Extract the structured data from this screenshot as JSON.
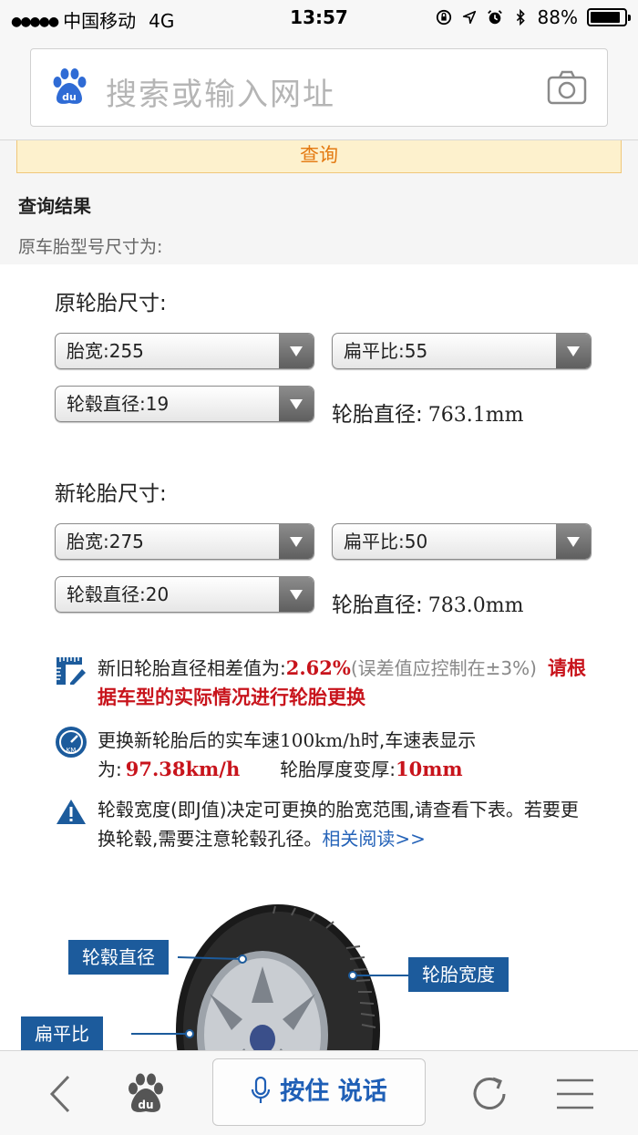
{
  "status_bar": {
    "signal": "●●●●●",
    "carrier": "中国移动",
    "network": "4G",
    "time": "13:57",
    "battery": "88%",
    "battery_level": 0.88
  },
  "search": {
    "placeholder": "搜索或输入网址",
    "logo_text": "du"
  },
  "query_button": "查询",
  "result": {
    "title": "查询结果",
    "subtitle": "原车胎型号尺寸为:"
  },
  "original": {
    "label": "原轮胎尺寸:",
    "width": "胎宽:255",
    "aspect": "扁平比:55",
    "rim": "轮毂直径:19",
    "diameter_label": "轮胎直径:",
    "diameter_value": "763.1mm"
  },
  "new": {
    "label": "新轮胎尺寸:",
    "width": "胎宽:275",
    "aspect": "扁平比:50",
    "rim": "轮毂直径:20",
    "diameter_label": "轮胎直径:",
    "diameter_value": "783.0mm"
  },
  "info": {
    "diff_prefix": "新旧轮胎直径相差值为:",
    "diff_value": "2.62%",
    "diff_note": "(误差值应控制在±3%)",
    "diff_advice": "请根据车型的实际情况进行轮胎更换",
    "speed_prefix": "更换新轮胎后的实车速",
    "speed_base": "100km/h",
    "speed_mid": "时,车速表显示为:",
    "speed_value": "97.38km/h",
    "thickness_label": "轮胎厚度变厚:",
    "thickness_value": "10mm",
    "rim_note": "轮毂宽度(即J值)决定可更换的胎宽范围,请查看下表。若要更换轮毂,需要注意轮毂孔径。",
    "rim_link": "相关阅读>>"
  },
  "diagram": {
    "rim_diameter": "轮毂直径",
    "tire_width": "轮胎宽度",
    "aspect_ratio": "扁平比"
  },
  "toolbar": {
    "voice": "按住 说话",
    "logo_text": "du"
  },
  "colors": {
    "accent_blue": "#1c5b9c",
    "warning_red": "#c8141c",
    "query_orange": "#e47a12"
  }
}
